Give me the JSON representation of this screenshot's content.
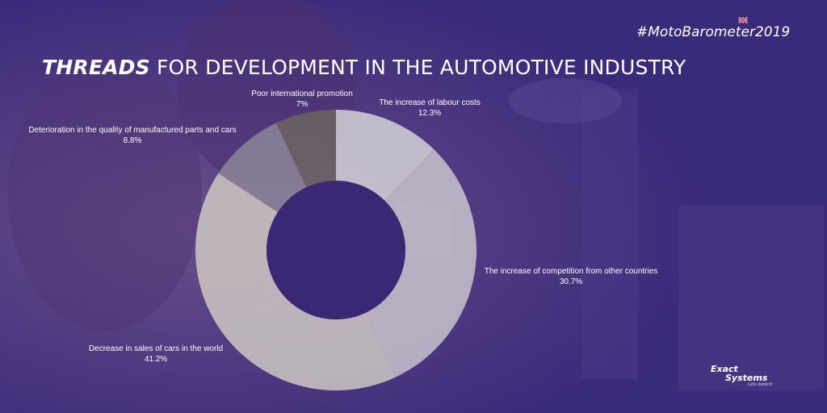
{
  "header": {
    "hashtag": "#MotoBarometer2019",
    "title_strong": "THREADS",
    "title_rest": " FOR DEVELOPMENT IN THE AUTOMOTIVE INDUSTRY"
  },
  "logo": {
    "line1": "Exact",
    "line2": "Systems",
    "tagline": "Let's check it!"
  },
  "colors": {
    "background": "#3a2a7a",
    "accent": "#ffffff"
  },
  "chart_data": {
    "type": "pie",
    "subtype": "donut",
    "slices": [
      {
        "label": "The increase of labour costs",
        "value": 12.3,
        "value_label": "12.3%",
        "color": "#d9d8dc"
      },
      {
        "label": "The increase of competition from other countries",
        "value": 30.7,
        "value_label": "30.7%",
        "color": "#cdc8cf"
      },
      {
        "label": "Decrease in sales of cars in the world",
        "value": 41.2,
        "value_label": "41.2%",
        "color": "#d2cdc6"
      },
      {
        "label": "Deterioration in the quality of manufactured parts and cars",
        "value": 8.8,
        "value_label": "8.8%",
        "color": "#8e8898"
      },
      {
        "label": "Poor international promotion",
        "value": 7,
        "value_label": "7%",
        "color": "#6e6660"
      }
    ]
  }
}
